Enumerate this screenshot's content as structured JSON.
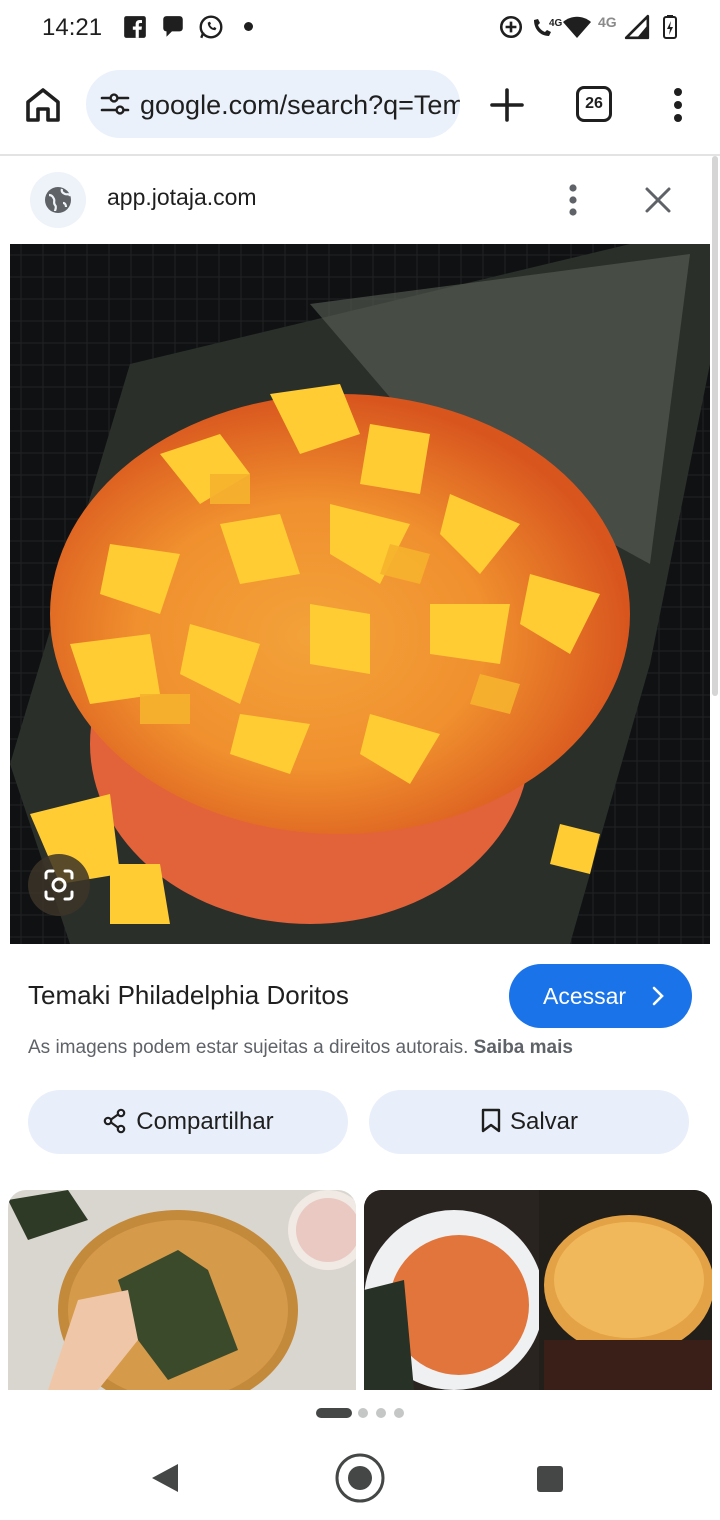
{
  "status_bar": {
    "time": "14:21",
    "left_icons": [
      "facebook-icon",
      "chat-bubble-icon",
      "whatsapp-icon",
      "notification-dot-icon"
    ],
    "right_icons": [
      "data-saver-icon",
      "volte-call-icon",
      "wifi-icon",
      "signal-icon",
      "battery-charging-icon"
    ],
    "network_label_1": "4G",
    "network_label_2": "4G"
  },
  "browser": {
    "url": "google.com/search?q=Temaki",
    "tab_count": "26"
  },
  "panel": {
    "source_domain": "app.jotaja.com"
  },
  "result": {
    "title": "Temaki Philadelphia Doritos",
    "visit_label": "Acessar",
    "copyright_text": "As imagens podem estar sujeitas a direitos autorais.",
    "learn_more": "Saiba mais",
    "share_label": "Compartilhar",
    "save_label": "Salvar"
  },
  "colors": {
    "accent": "#1a73e8",
    "pill_bg": "#e8effa",
    "url_bg": "#eaf1fb"
  }
}
